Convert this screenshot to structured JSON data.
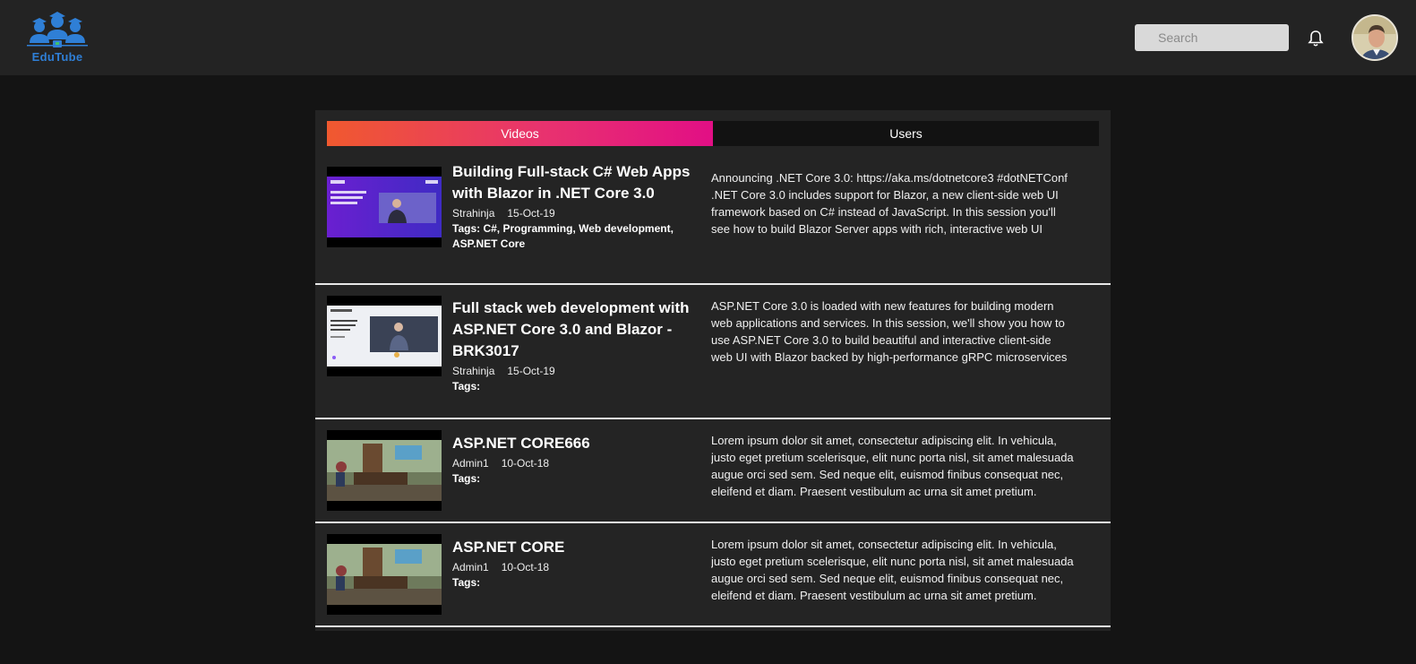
{
  "app": {
    "logo_text": "EduTube"
  },
  "header": {
    "search_placeholder": "Search",
    "bell_icon": "bell-icon",
    "avatar": "user-avatar"
  },
  "tabs": [
    {
      "label": "Videos",
      "active": true
    },
    {
      "label": "Users",
      "active": false
    }
  ],
  "videos": [
    {
      "title": "Building Full-stack C# Web Apps with Blazor in .NET Core 3.0",
      "author": "Strahinja",
      "date": "15-Oct-19",
      "tags": "Tags: C#, Programming, Web development, ASP.NET Core",
      "description": "Announcing .NET Core 3.0: https://aka.ms/dotnetcore3 #dotNETConf .NET Core 3.0 includes support for Blazor, a new client-side web UI framework based on C# instead of JavaScript. In this session you'll see how to build Blazor Server apps with rich, interactive web UI where all"
    },
    {
      "title": "Full stack web development with ASP.NET Core 3.0 and Blazor - BRK3017",
      "author": "Strahinja",
      "date": "15-Oct-19",
      "tags": "Tags:",
      "description": "ASP.NET Core 3.0 is loaded with new features for building modern web applications and services. In this session, we'll show you how to use ASP.NET Core 3.0 to build beautiful and interactive client-side web UI with Blazor backed by high-performance gRPC microservices and long-"
    },
    {
      "title": "ASP.NET CORE666",
      "author": "Admin1",
      "date": "10-Oct-18",
      "tags": "Tags:",
      "description": "Lorem ipsum dolor sit amet, consectetur adipiscing elit. In vehicula, justo eget pretium scelerisque, elit nunc porta nisl, sit amet malesuada augue orci sed sem. Sed neque elit, euismod finibus consequat nec, eleifend et diam. Praesent vestibulum ac urna sit amet pretium."
    },
    {
      "title": "ASP.NET CORE",
      "author": "Admin1",
      "date": "10-Oct-18",
      "tags": "Tags:",
      "description": "Lorem ipsum dolor sit amet, consectetur adipiscing elit. In vehicula, justo eget pretium scelerisque, elit nunc porta nisl, sit amet malesuada augue orci sed sem. Sed neque elit, euismod finibus consequat nec, eleifend et diam. Praesent vestibulum ac urna sit amet pretium."
    }
  ],
  "colors": {
    "tab_gradient_start": "#f0592f",
    "tab_gradient_end": "#e20f85",
    "logo_blue": "#2f7fd6"
  }
}
